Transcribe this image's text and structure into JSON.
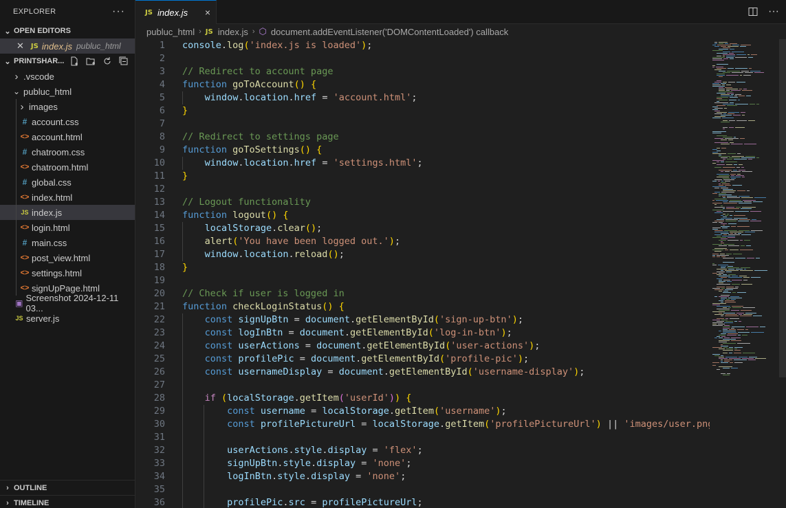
{
  "sidebar": {
    "title": "EXPLORER",
    "more_icon": "ellipsis-icon",
    "open_editors": {
      "label": "OPEN EDITORS",
      "items": [
        {
          "name": "index.js",
          "desc": "publuc_html",
          "icon": "js-file-icon"
        }
      ]
    },
    "project": {
      "label": "PRINTSHAR...",
      "tools": [
        "new-file-icon",
        "new-folder-icon",
        "refresh-icon",
        "collapse-all-icon"
      ],
      "tree": [
        {
          "label": ".vscode",
          "kind": "folder-collapsed"
        },
        {
          "label": "publuc_html",
          "kind": "folder-expanded"
        },
        {
          "label": "images",
          "kind": "folder-collapsed"
        },
        {
          "label": "account.css",
          "kind": "css"
        },
        {
          "label": "account.html",
          "kind": "html"
        },
        {
          "label": "chatroom.css",
          "kind": "css"
        },
        {
          "label": "chatroom.html",
          "kind": "html"
        },
        {
          "label": "global.css",
          "kind": "css"
        },
        {
          "label": "index.html",
          "kind": "html"
        },
        {
          "label": "index.js",
          "kind": "js",
          "active": true
        },
        {
          "label": "login.html",
          "kind": "html"
        },
        {
          "label": "main.css",
          "kind": "css"
        },
        {
          "label": "post_view.html",
          "kind": "html"
        },
        {
          "label": "settings.html",
          "kind": "html"
        },
        {
          "label": "signUpPage.html",
          "kind": "html"
        },
        {
          "label": "Screenshot 2024-12-11 03...",
          "kind": "image"
        },
        {
          "label": "server.js",
          "kind": "js"
        }
      ]
    },
    "outline_label": "OUTLINE",
    "timeline_label": "TIMELINE"
  },
  "tabs": [
    {
      "label": "index.js",
      "icon_text": "JS",
      "close": "×"
    }
  ],
  "breadcrumb": {
    "folder": "publuc_html",
    "file": "index.js",
    "symbol": "document.addEventListener('DOMContentLoaded') callback"
  },
  "colors": {
    "accent": "#0078d4",
    "editor_bg": "#1f1f1f",
    "sidebar_bg": "#181818"
  },
  "editor": {
    "lines": [
      "console.log('index.js is loaded');",
      "",
      "// Redirect to account page",
      "function goToAccount() {",
      "    window.location.href = 'account.html';",
      "}",
      "",
      "// Redirect to settings page",
      "function goToSettings() {",
      "    window.location.href = 'settings.html';",
      "}",
      "",
      "// Logout functionality",
      "function logout() {",
      "    localStorage.clear();",
      "    alert('You have been logged out.');",
      "    window.location.reload();",
      "}",
      "",
      "// Check if user is logged in",
      "function checkLoginStatus() {",
      "    const signUpBtn = document.getElementById('sign-up-btn');",
      "    const logInBtn = document.getElementById('log-in-btn');",
      "    const userActions = document.getElementById('user-actions');",
      "    const profilePic = document.getElementById('profile-pic');",
      "    const usernameDisplay = document.getElementById('username-display');",
      "",
      "    if (localStorage.getItem('userId')) {",
      "        const username = localStorage.getItem('username');",
      "        const profilePictureUrl = localStorage.getItem('profilePictureUrl') || 'images/user.png';",
      "",
      "        userActions.style.display = 'flex';",
      "        signUpBtn.style.display = 'none';",
      "        logInBtn.style.display = 'none';",
      "",
      "        profilePic.src = profilePictureUrl;"
    ]
  }
}
